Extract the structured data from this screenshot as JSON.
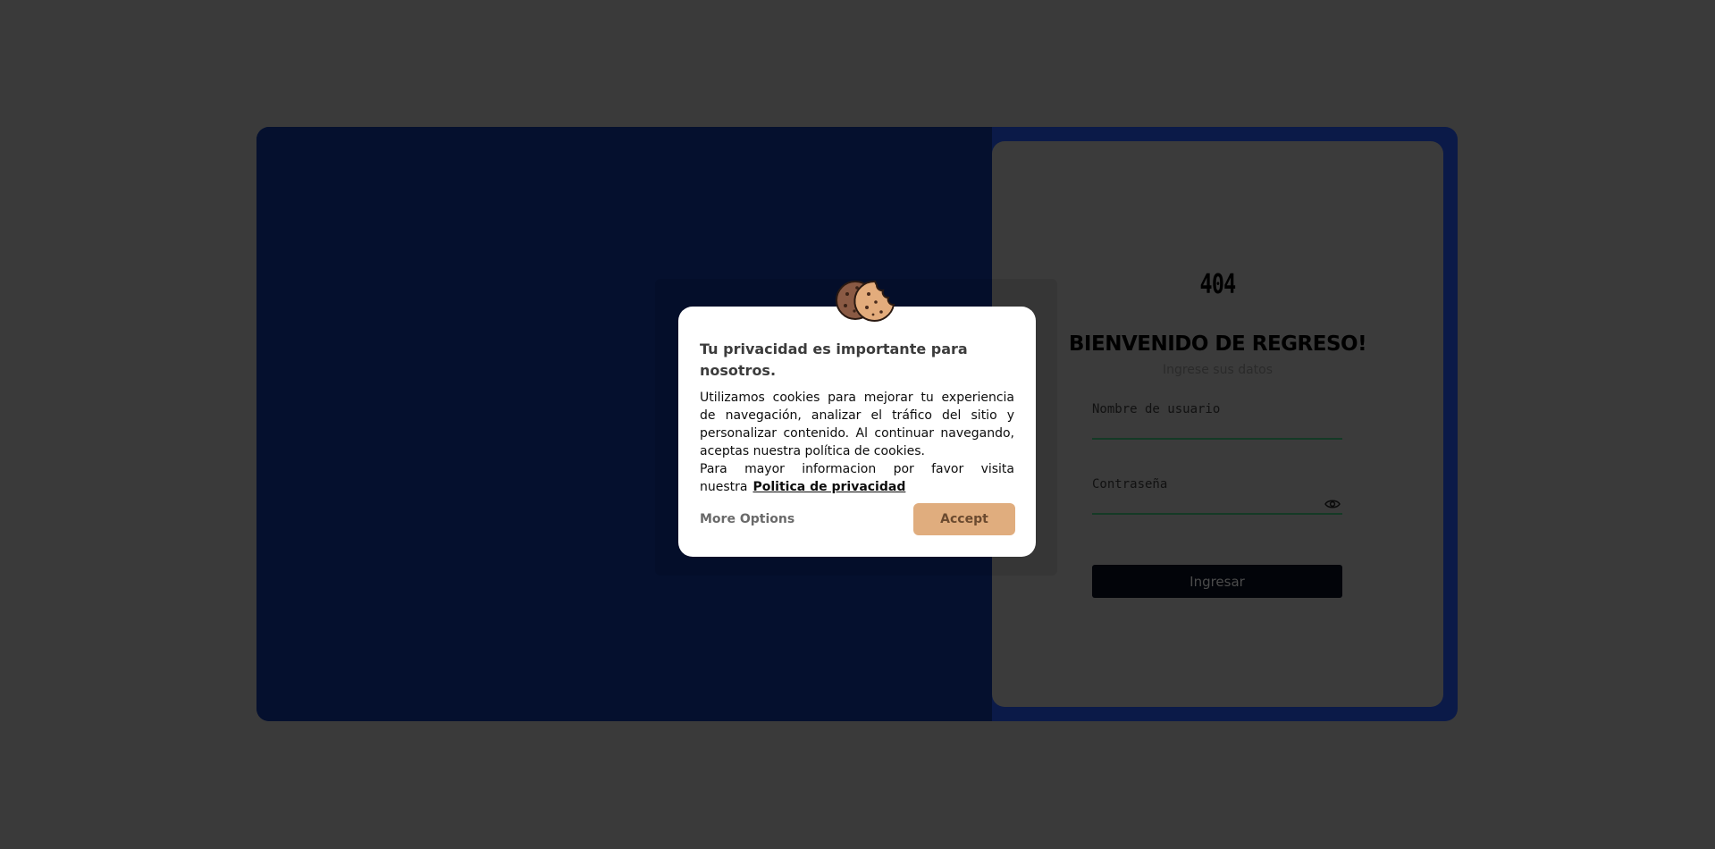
{
  "login": {
    "logo_text": "404",
    "welcome_title": "BIENVENIDO DE REGRESO!",
    "subtitle": "Ingrese sus datos",
    "username_placeholder": "Nombre de usuario",
    "password_placeholder": "Contraseña",
    "submit_label": "Ingresar",
    "password_toggle_icon": "eye-icon"
  },
  "cookie_modal": {
    "icon": "cookie-icon",
    "title": "Tu privacidad es importante para nosotros.",
    "body_text": "Utilizamos cookies para mejorar tu experiencia de navegación, analizar el tráfico del sitio y personalizar contenido. Al continuar navegando, aceptas nuestra política de cookies.",
    "more_info_text": "Para mayor informacion por favor visita nuestra",
    "privacy_link_label": "Politica de privacidad",
    "more_options_label": "More Options",
    "accept_label": "Accept"
  },
  "colors": {
    "page_overlay": "#3a3a3a",
    "card_background": "#0b1a48",
    "left_panel": "#05102e",
    "login_panel": "#3b3b3b",
    "accept_button": "#e0ad7e",
    "submit_button": "#020409"
  }
}
